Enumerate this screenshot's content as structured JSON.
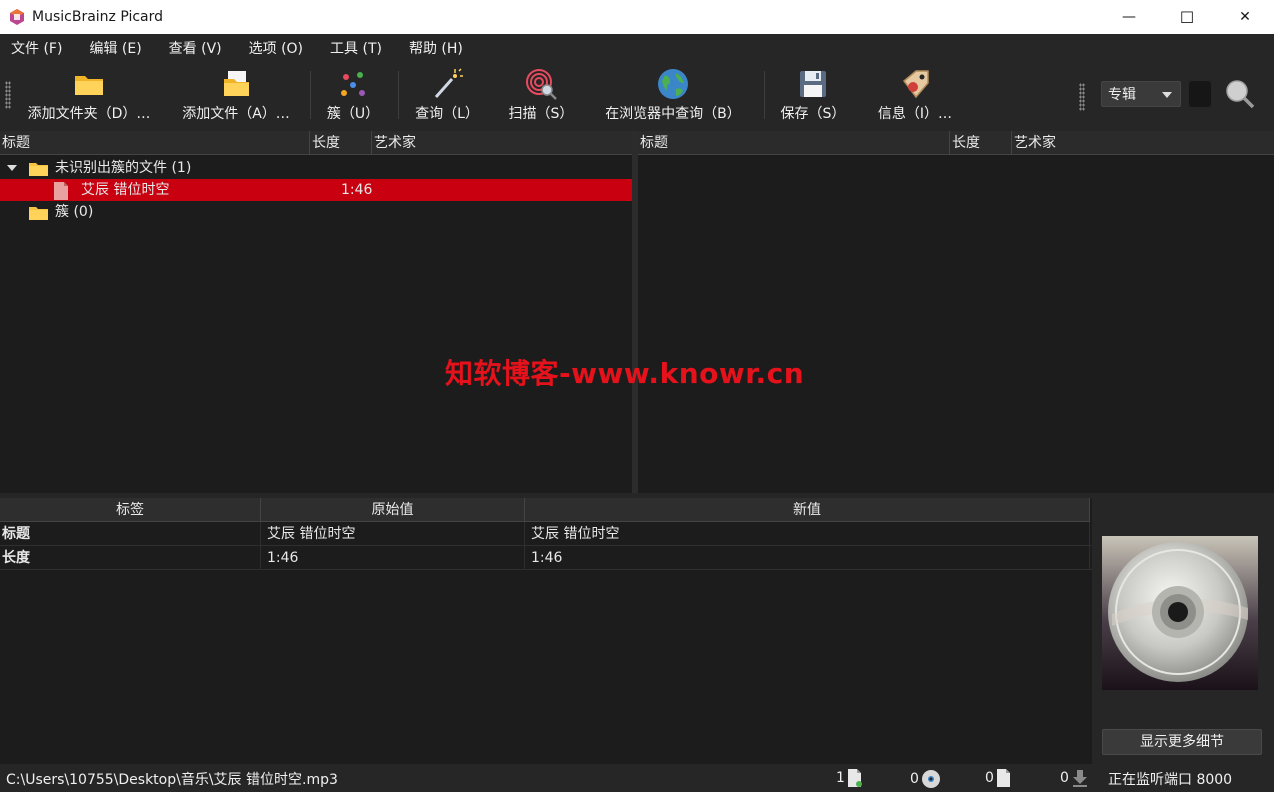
{
  "window": {
    "title": "MusicBrainz Picard",
    "minimize": "—",
    "maximize": "☐",
    "close": "✕"
  },
  "menu": [
    "文件 (F)",
    "编辑 (E)",
    "查看 (V)",
    "选项 (O)",
    "工具 (T)",
    "帮助 (H)"
  ],
  "toolbar": {
    "add_folder": "添加文件夹（D）…",
    "add_files": "添加文件（A）…",
    "cluster": "簇（U）",
    "lookup": "查询（L）",
    "scan": "扫描（S）",
    "browser_lookup": "在浏览器中查询（B）",
    "save": "保存（S）",
    "info": "信息（I）…",
    "search_type": "专辑"
  },
  "left_pane": {
    "headers": [
      "标题",
      "长度",
      "艺术家"
    ],
    "unclustered": "未识别出簇的文件 (1)",
    "file": {
      "title": "艾辰 错位时空",
      "length": "1:46",
      "artist": ""
    },
    "clusters": "簇 (0)"
  },
  "right_pane": {
    "headers": [
      "标题",
      "长度",
      "艺术家"
    ]
  },
  "metadata": {
    "headers": [
      "标签",
      "原始值",
      "新值"
    ],
    "rows": [
      {
        "tag": "标题",
        "original": "艾辰 错位时空",
        "new": "艾辰 错位时空"
      },
      {
        "tag": "长度",
        "original": "1:46",
        "new": "1:46"
      }
    ]
  },
  "cover": {
    "more_details": "显示更多细节"
  },
  "status": {
    "path": "C:\\Users\\10755\\Desktop\\音乐\\艾辰 错位时空.mp3",
    "files": "1",
    "albums": "0",
    "pending_files": "0",
    "pending_requests": "0",
    "listening": "正在监听端口 8000"
  },
  "watermark": "知软博客-www.knowr.cn",
  "colors": {
    "selection": "#c8000f",
    "folder": "#f5c542",
    "watermark": "#e5121b"
  }
}
